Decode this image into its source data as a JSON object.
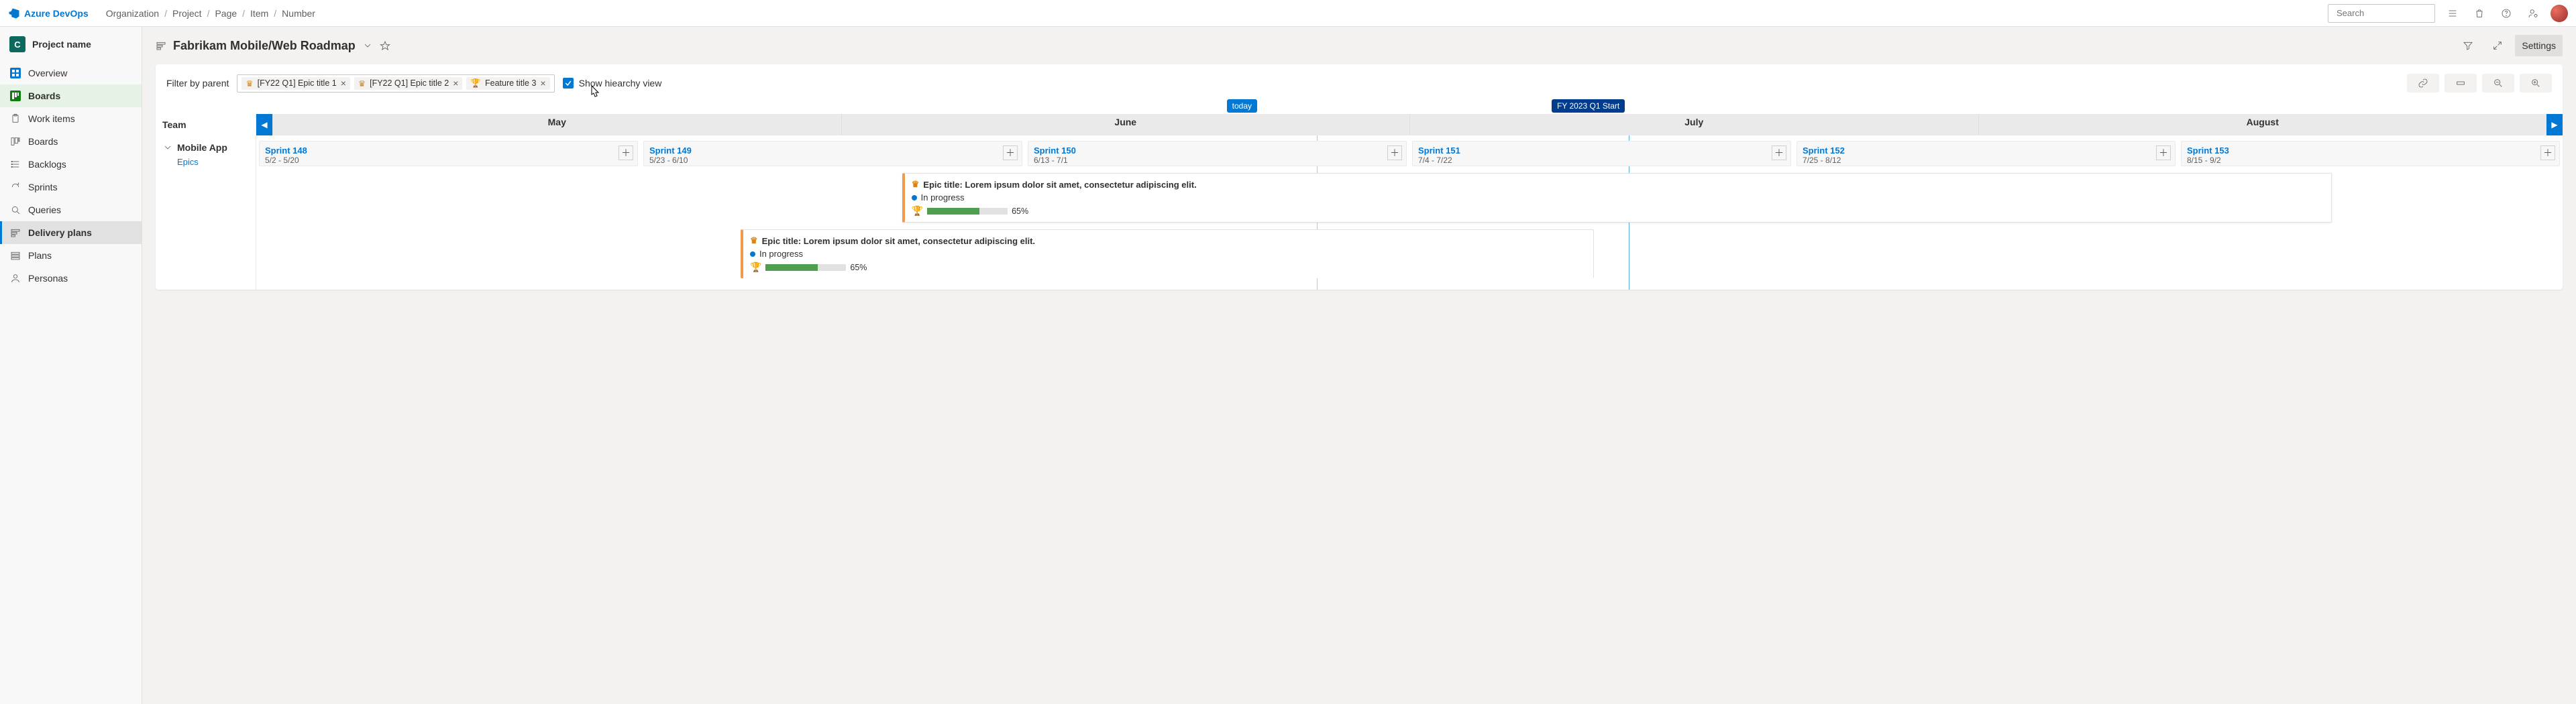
{
  "logo": "Azure DevOps",
  "breadcrumb": [
    "Organization",
    "Project",
    "Page",
    "Item",
    "Number"
  ],
  "search_placeholder": "Search",
  "project": {
    "badge": "C",
    "name": "Project name"
  },
  "nav": {
    "overview": "Overview",
    "boards": "Boards",
    "sub": [
      "Work items",
      "Boards",
      "Backlogs",
      "Sprints",
      "Queries",
      "Delivery plans",
      "Plans",
      "Personas"
    ],
    "selected": "Delivery plans"
  },
  "page": {
    "title": "Fabrikam Mobile/Web Roadmap",
    "settings": "Settings"
  },
  "filter": {
    "label": "Filter by parent",
    "chips": [
      {
        "kind": "epic",
        "label": "[FY22 Q1] Epic title 1"
      },
      {
        "kind": "epic",
        "label": "[FY22 Q1] Epic title 2"
      },
      {
        "kind": "feature",
        "label": "Feature title 3"
      }
    ],
    "checkbox_label": "Show hiearchy view"
  },
  "markers": {
    "today": "today",
    "fy": "FY 2023 Q1 Start"
  },
  "team_col": "Team",
  "months": [
    "May",
    "June",
    "July",
    "August"
  ],
  "group": {
    "name": "Mobile App",
    "sub": "Epics"
  },
  "sprints": [
    {
      "name": "Sprint 148",
      "dates": "5/2 - 5/20"
    },
    {
      "name": "Sprint 149",
      "dates": "5/23 - 6/10"
    },
    {
      "name": "Sprint 150",
      "dates": "6/13 - 7/1"
    },
    {
      "name": "Sprint 151",
      "dates": "7/4 - 7/22"
    },
    {
      "name": "Sprint 152",
      "dates": "7/25 - 8/12"
    },
    {
      "name": "Sprint 153",
      "dates": "8/15 - 9/2"
    }
  ],
  "epics": [
    {
      "title": "Epic title: Lorem ipsum dolor sit amet, consectetur adipiscing elit.",
      "status": "In progress",
      "pct": "65%"
    },
    {
      "title": "Epic title: Lorem ipsum dolor sit amet, consectetur adipiscing elit.",
      "status": "In progress",
      "pct": "65%"
    }
  ]
}
